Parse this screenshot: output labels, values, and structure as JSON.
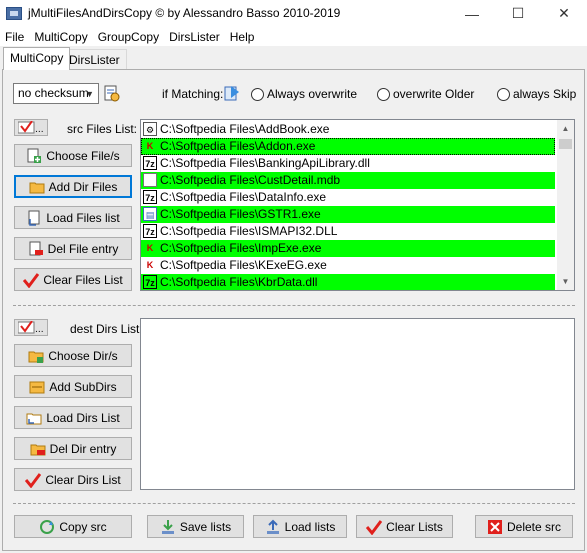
{
  "window": {
    "title": "jMultiFilesAndDirsCopy  © by Alessandro Basso 2010-2019",
    "minimize": "—",
    "maximize": "☐",
    "close": "✕"
  },
  "menu": [
    "File",
    "MultiCopy",
    "GroupCopy",
    "DirsLister",
    "Help"
  ],
  "tabs": [
    {
      "label": "MultiCopy",
      "active": true
    },
    {
      "label": "DirsLister",
      "active": false
    }
  ],
  "options": {
    "checksum": "no checksum",
    "if_matching_label": "if Matching:",
    "radios": [
      "Always overwrite",
      "overwrite Older",
      "always Skip"
    ]
  },
  "src": {
    "label": "src Files List:",
    "buttons": [
      "Choose File/s",
      "Add Dir Files",
      "Load Files list",
      "Del File entry",
      "Clear Files List"
    ],
    "files": [
      {
        "path": "C:\\Softpedia Files\\AddBook.exe",
        "icon": "gear",
        "highlight": false
      },
      {
        "path": "C:\\Softpedia Files\\Addon.exe",
        "icon": "ka",
        "highlight": true
      },
      {
        "path": "C:\\Softpedia Files\\BankingApiLibrary.dll",
        "icon": "7z",
        "highlight": false
      },
      {
        "path": "C:\\Softpedia Files\\CustDetail.mdb",
        "icon": "doc",
        "highlight": true
      },
      {
        "path": "C:\\Softpedia Files\\DataInfo.exe",
        "icon": "7z",
        "highlight": false
      },
      {
        "path": "C:\\Softpedia Files\\GSTR1.exe",
        "icon": "win",
        "highlight": true
      },
      {
        "path": "C:\\Softpedia Files\\ISMAPI32.DLL",
        "icon": "7z",
        "highlight": false
      },
      {
        "path": "C:\\Softpedia Files\\ImpExe.exe",
        "icon": "ka",
        "highlight": true
      },
      {
        "path": "C:\\Softpedia Files\\KExeEG.exe",
        "icon": "ka",
        "highlight": false
      },
      {
        "path": "C:\\Softpedia Files\\KbrData.dll",
        "icon": "7z",
        "highlight": true
      }
    ]
  },
  "dest": {
    "label": "dest Dirs List:",
    "buttons": [
      "Choose Dir/s",
      "Add SubDirs",
      "Load Dirs List",
      "Del Dir entry",
      "Clear Dirs List"
    ]
  },
  "bottom": [
    "Copy src",
    "Save lists",
    "Load lists",
    "Clear Lists",
    "Delete src"
  ],
  "colors": {
    "highlight": "#00ff00",
    "focus": "#0078d7",
    "accent_red": "#e0201c",
    "folder": "#f5b942"
  }
}
